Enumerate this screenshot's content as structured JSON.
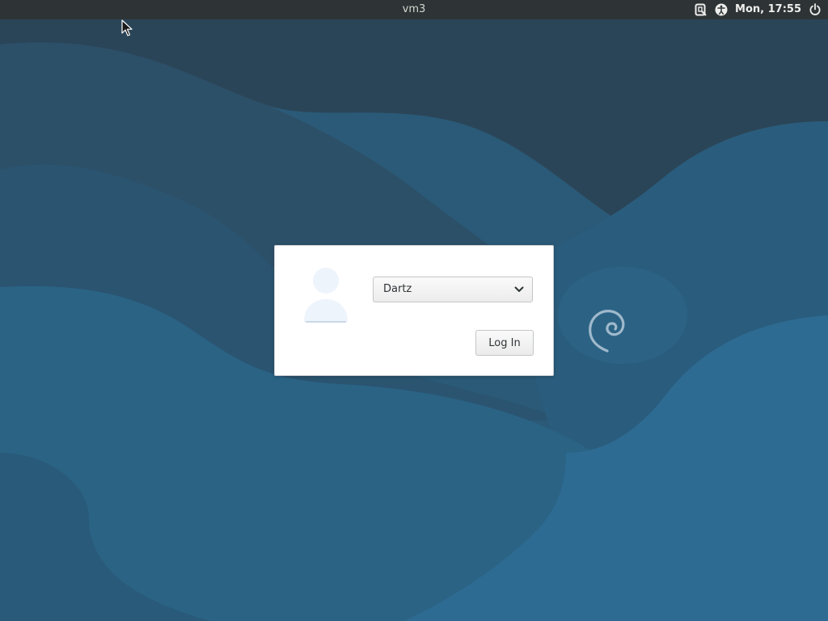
{
  "top_panel": {
    "hostname": "vm3",
    "clock": "Mon, 17:55",
    "indicators": [
      {
        "name": "onboard-keyboard-icon"
      },
      {
        "name": "accessibility-icon"
      },
      {
        "name": "power-icon"
      }
    ]
  },
  "login": {
    "selected_user": "Dartz",
    "login_button_label": "Log In",
    "avatar_icon": "user-avatar-icon",
    "user_list_options": [
      "Dartz"
    ]
  },
  "wallpaper": {
    "logo": "debian-swirl",
    "colors": {
      "background_dark": "#2b4a5f",
      "background_mid": "#285a78",
      "background_light": "#2d6b92",
      "logo_color": "#9fb9cc"
    }
  },
  "colors": {
    "panel_bg": "#2e3436",
    "panel_text": "#eeeeec",
    "dialog_bg": "#ffffff"
  }
}
